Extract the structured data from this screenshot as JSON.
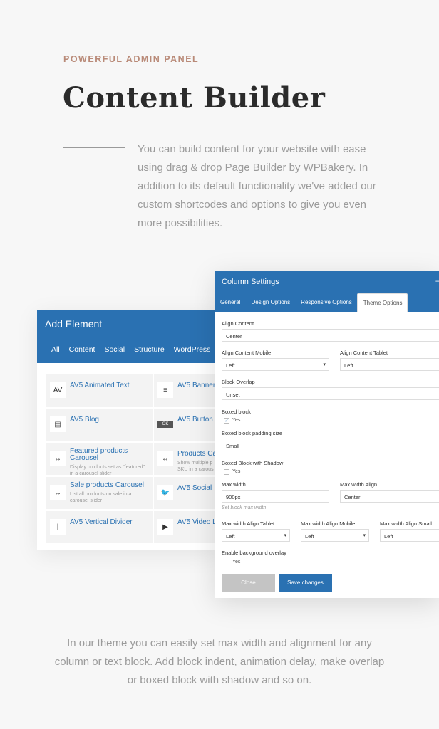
{
  "header": {
    "eyebrow": "POWERFUL ADMIN PANEL",
    "title": "Content Builder",
    "intro": "You can build content for your website with ease using drag & drop Page Builder by WPBakery. In addition to its default functionality we've added our custom shortcodes and options to give you even more possibilities."
  },
  "add_element": {
    "title": "Add Element",
    "tabs": [
      "All",
      "Content",
      "Social",
      "Structure",
      "WordPress"
    ],
    "items": [
      {
        "icon": "AV",
        "name": "AV5 Animated Text",
        "desc": ""
      },
      {
        "icon": "≡",
        "name": "AV5 Banner",
        "desc": ""
      },
      {
        "icon": "▤",
        "name": "AV5 Blog",
        "desc": ""
      },
      {
        "icon": "OK",
        "name": "AV5 Button",
        "desc": ""
      },
      {
        "icon": "↔",
        "name": "Featured products Carousel",
        "desc": "Display products set as \"featured\" in a carousel slider"
      },
      {
        "icon": "↔",
        "name": "Products Ca",
        "desc": "Show multiple p SKU in a carous"
      },
      {
        "icon": "↔",
        "name": "Sale products Carousel",
        "desc": "List all products on sale in a carousel slider"
      },
      {
        "icon": "🐦",
        "name": "AV5 Social",
        "desc": ""
      },
      {
        "icon": "|",
        "name": "AV5 Vertical Divider",
        "desc": ""
      },
      {
        "icon": "▶",
        "name": "AV5 Video L",
        "desc": ""
      }
    ]
  },
  "column_settings": {
    "title": "Column Settings",
    "close_glyph": "–",
    "tabs": [
      "General",
      "Design Options",
      "Responsive Options",
      "Theme Options"
    ],
    "active_tab": "Theme Options",
    "fields": {
      "align_content": {
        "label": "Align Content",
        "value": "Center"
      },
      "align_content_mobile": {
        "label": "Align Content Mobile",
        "value": "Left"
      },
      "align_content_tablet": {
        "label": "Align Content Tablet",
        "value": "Left"
      },
      "block_overlap": {
        "label": "Block Overlap",
        "value": "Unset"
      },
      "boxed_block": {
        "label": "Boxed block",
        "checkbox": "Yes"
      },
      "boxed_padding": {
        "label": "Boxed block padding size",
        "value": "Small"
      },
      "boxed_shadow": {
        "label": "Boxed Block with Shadow",
        "checkbox": "Yes"
      },
      "max_width": {
        "label": "Max width",
        "value": "900px",
        "hint": "Set block max width"
      },
      "max_width_align": {
        "label": "Max width Align",
        "value": "Center"
      },
      "mw_align_tablet": {
        "label": "Max width Align Tablet",
        "value": "Left"
      },
      "mw_align_mobile": {
        "label": "Max width Align Mobile",
        "value": "Left"
      },
      "mw_align_small": {
        "label": "Max width Align Small",
        "value": "Left"
      },
      "bg_overlay": {
        "label": "Enable background overlay",
        "checkbox": "Yes"
      }
    },
    "buttons": {
      "close": "Close",
      "save": "Save changes"
    }
  },
  "outro": "In our theme you can easily set max width and alignment for any column or text block. Add block indent, animation delay, make overlap or boxed block with shadow and so on.",
  "colors": {
    "accent": "#2a71b2",
    "eyebrow": "#b98a78"
  }
}
